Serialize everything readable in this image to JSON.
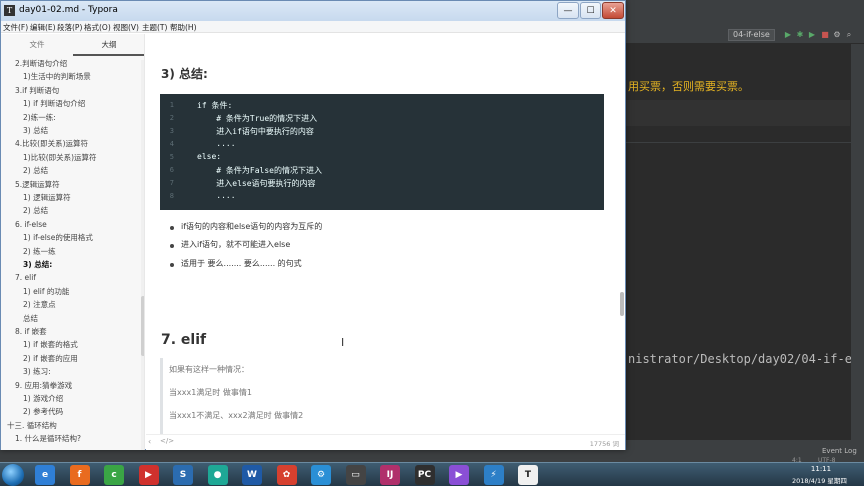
{
  "window": {
    "title": "day01-02.md - Typora",
    "minimize": "—",
    "maximize": "☐",
    "close": "✕"
  },
  "menu": [
    "文件(F)",
    "编辑(E)",
    "段落(P)",
    "格式(O)",
    "视图(V)",
    "主题(T)",
    "帮助(H)"
  ],
  "sidebar": {
    "tabs": [
      "文件",
      "大纲"
    ],
    "outline": [
      {
        "text": "2.判断语句介绍",
        "level": 1
      },
      {
        "text": "1)生活中的判断场景",
        "level": 2
      },
      {
        "text": "3.if 判断语句",
        "level": 1
      },
      {
        "text": "1) if 判断语句介绍",
        "level": 2
      },
      {
        "text": "2)练一练:",
        "level": 2
      },
      {
        "text": "3) 总结",
        "level": 2
      },
      {
        "text": "4.比较(即关系)运算符",
        "level": 1
      },
      {
        "text": "1)比较(即关系)运算符",
        "level": 2
      },
      {
        "text": "2) 总结",
        "level": 2
      },
      {
        "text": "5.逻辑运算符",
        "level": 1
      },
      {
        "text": "1) 逻辑运算符",
        "level": 2
      },
      {
        "text": "2) 总结",
        "level": 2
      },
      {
        "text": "6. if-else",
        "level": 1
      },
      {
        "text": "1) if-else的使用格式",
        "level": 2
      },
      {
        "text": "2) 练一练",
        "level": 2
      },
      {
        "text": "3) 总结:",
        "level": 2,
        "active": true
      },
      {
        "text": "7. elif",
        "level": 1
      },
      {
        "text": "1) elif 的功能",
        "level": 2
      },
      {
        "text": "2) 注意点",
        "level": 2
      },
      {
        "text": "总结",
        "level": 2
      },
      {
        "text": "8. if 嵌套",
        "level": 1
      },
      {
        "text": "1) if 嵌套的格式",
        "level": 2
      },
      {
        "text": "2) if 嵌套的应用",
        "level": 2
      },
      {
        "text": "3) 练习:",
        "level": 2
      },
      {
        "text": "9. 应用:猜拳游戏",
        "level": 1
      },
      {
        "text": "1) 游戏介绍",
        "level": 2
      },
      {
        "text": "2) 参考代码",
        "level": 2
      },
      {
        "text": "十三. 循环结构",
        "level": 0
      },
      {
        "text": "1. 什么是循环结构?",
        "level": 1
      }
    ]
  },
  "doc": {
    "summary_heading": "3) 总结:",
    "code_lines": [
      {
        "n": "1",
        "code": "if 条件:"
      },
      {
        "n": "2",
        "code": "    # 条件为True的情况下进入"
      },
      {
        "n": "3",
        "code": "    进入if语句中要执行的内容"
      },
      {
        "n": "4",
        "code": "    ...."
      },
      {
        "n": "5",
        "code": "else:"
      },
      {
        "n": "6",
        "code": "    # 条件为False的情况下进入"
      },
      {
        "n": "7",
        "code": "    进入else语句要执行的内容"
      },
      {
        "n": "8",
        "code": "    ...."
      }
    ],
    "bullets": [
      "if语句的内容和else语句的内容为互斥的",
      "进入if语句，就不可能进入else",
      "适用于  要么.......  要么...... 的句式"
    ],
    "elif_heading": "7.   elif",
    "quote_lines": [
      "如果有这样一种情况：",
      "当xxx1满足时    做事情1",
      "当xxx1不满足、xxx2满足时      做事情2"
    ]
  },
  "statusbar": {
    "back": "‹",
    "code_toggle": "</>",
    "word_count": "17756 词"
  },
  "ide": {
    "run_config": "04-if-else",
    "code_text": "用买票，否则需要买票。",
    "run_path": "nistrator/Desktop/day02/04-if-else.py",
    "event_log": "Event Log",
    "position": "4:1",
    "encoding": "UTF-8"
  },
  "taskbar": {
    "apps": [
      "e",
      "f",
      "c",
      "▶",
      "S",
      "●",
      "W",
      "✿",
      "⚙",
      "▭",
      "IJ",
      "PC",
      "▶",
      "⚡",
      "T"
    ],
    "time": "11:11",
    "date": "2018/4/19 星期四"
  },
  "colors": {
    "code_bg": "#263238",
    "ide_bg": "#2b2b2b",
    "ide_string": "#e6b422",
    "title_gradient": "#c7d9ee"
  }
}
